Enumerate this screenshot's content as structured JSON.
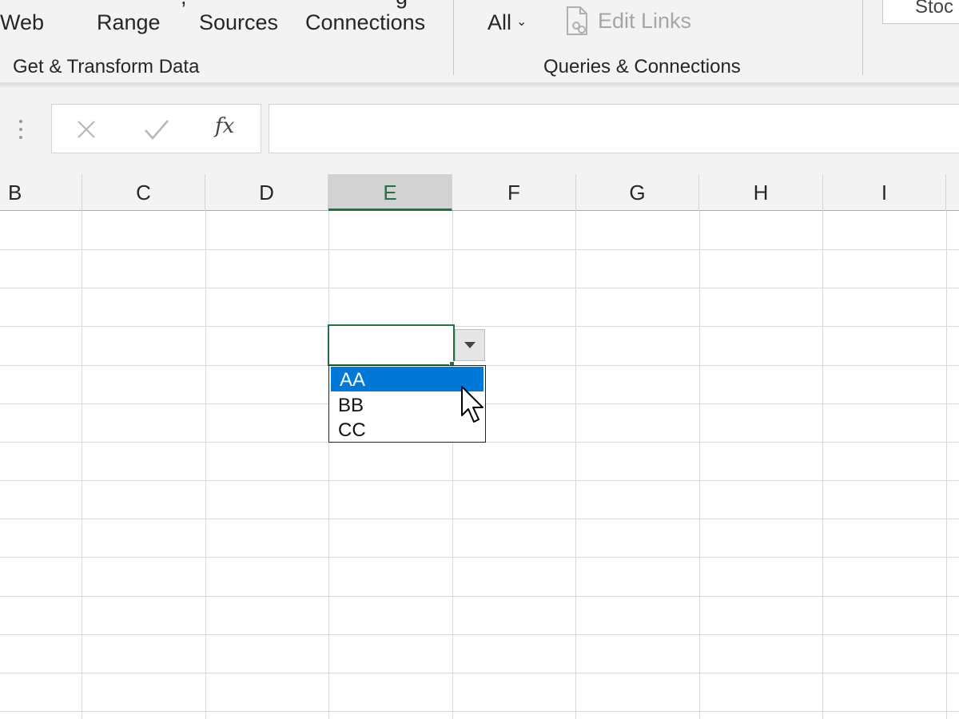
{
  "ribbon": {
    "get_transform_group": {
      "buttons": [
        "Web",
        "Range",
        "Sources",
        "Connections"
      ],
      "label": "Get & Transform Data"
    },
    "queries_group": {
      "refresh_all_label": "All",
      "edit_links_label": "Edit Links",
      "label": "Queries & Connections"
    },
    "data_types_box_text": "Stoc"
  },
  "formula_bar": {
    "fx_label": "fx",
    "value": ""
  },
  "grid": {
    "columns": [
      "B",
      "C",
      "D",
      "E",
      "F",
      "G",
      "H",
      "I"
    ],
    "selected_column": "E",
    "active_cell_value": ""
  },
  "dropdown": {
    "options": [
      "AA",
      "BB",
      "CC"
    ],
    "highlighted": "AA"
  },
  "colors": {
    "excel_green": "#217346",
    "highlight_blue": "#0078d7",
    "ribbon_bg": "#f3f3f3",
    "gridline": "#d9d9d9"
  }
}
